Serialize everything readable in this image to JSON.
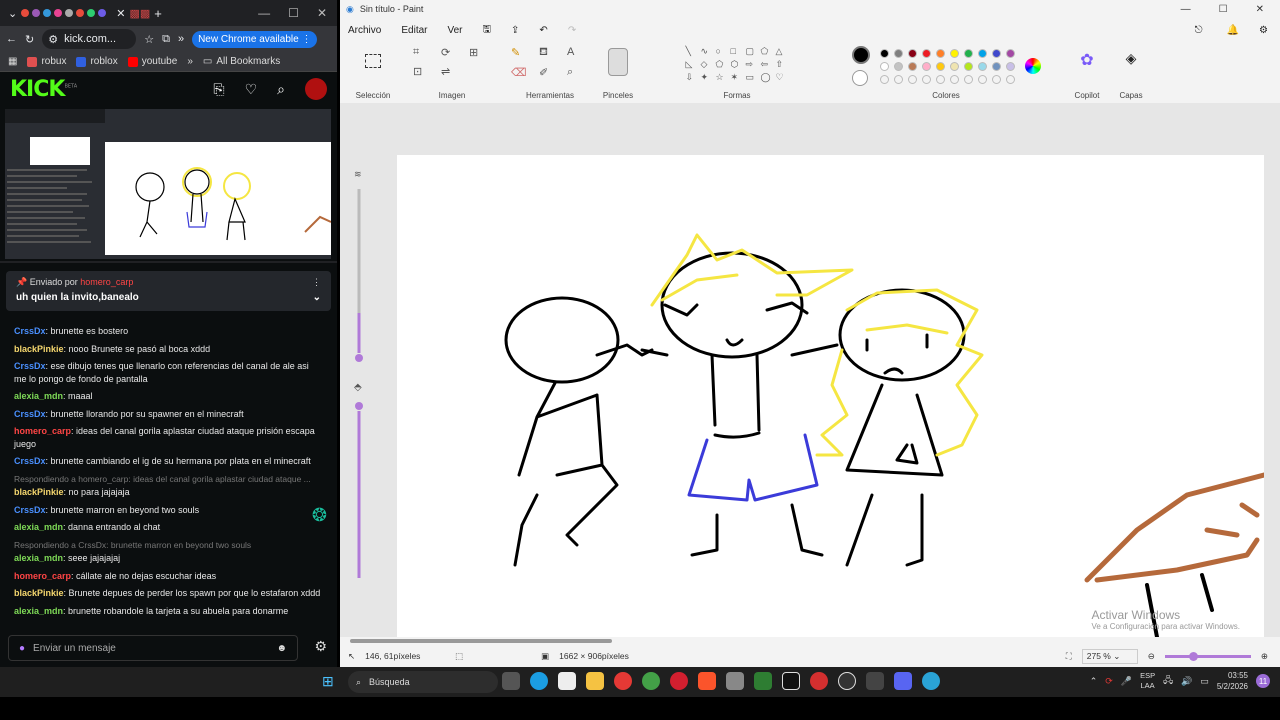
{
  "chrome": {
    "address_url": "kick.com...",
    "new_chrome_label": "New Chrome available",
    "bookmarks": [
      {
        "label": "robux",
        "color": "#e05050"
      },
      {
        "label": "roblox",
        "color": "#3060e0"
      },
      {
        "label": "youtube",
        "color": "#ff0000"
      }
    ],
    "bookmarks_more": "»",
    "all_bookmarks": "All Bookmarks"
  },
  "kick": {
    "logo": "KICK",
    "beta": "BETA",
    "brand_color": "#53fc18",
    "pinned": {
      "by_prefix": "Enviado por",
      "by_user": "homero_carp",
      "message": "uh quien la invito,banealo"
    },
    "chat": [
      {
        "user": "CrssDx",
        "color": "#4a90ff",
        "text": "brunette es bostero"
      },
      {
        "user": "blackPinkie",
        "color": "#f5d76e",
        "text": "nooo Brunete se pasó al boca xddd"
      },
      {
        "user": "CrssDx",
        "color": "#4a90ff",
        "text": "ese dibujo tenes que llenarlo con referencias del canal de ale asi me lo pongo de fondo de pantalla"
      },
      {
        "user": "alexia_mdn",
        "color": "#7ed957",
        "text": "maaal"
      },
      {
        "user": "CrssDx",
        "color": "#4a90ff",
        "text": "brunette llorando por su spawner en el minecraft"
      },
      {
        "user": "homero_carp",
        "color": "#ff4545",
        "text": "ideas del canal gorila aplastar ciudad ataque prisión escapa juego"
      },
      {
        "user": "CrssDx",
        "color": "#4a90ff",
        "text": "brunette cambiando el ig de su hermana por plata en el minecraft"
      },
      {
        "reply": "Respondiendo a homero_carp: ideas del canal gorila aplastar ciudad ataque ...",
        "user": "blackPinkie",
        "color": "#f5d76e",
        "text": "no para jajajaja"
      },
      {
        "user": "CrssDx",
        "color": "#4a90ff",
        "text": "brunette marron en beyond two souls"
      },
      {
        "user": "alexia_mdn",
        "color": "#7ed957",
        "text": "danna entrando al chat"
      },
      {
        "reply": "Respondiendo a CrssDx: brunette marron en beyond two souls",
        "user": "alexia_mdn",
        "color": "#7ed957",
        "text": "seee jajajajaj"
      },
      {
        "user": "homero_carp",
        "color": "#ff4545",
        "text": "cállate ale no dejas escuchar ideas"
      },
      {
        "user": "blackPinkie",
        "color": "#f5d76e",
        "text": "Brunete depues de perder los spawn por que lo estafaron xddd"
      },
      {
        "user": "alexia_mdn",
        "color": "#7ed957",
        "text": "brunette robandole la tarjeta a su abuela para donarme"
      }
    ],
    "input_placeholder": "Enviar un mensaje"
  },
  "paint": {
    "title": "Sin título - Paint",
    "menu": [
      "Archivo",
      "Editar",
      "Ver"
    ],
    "groups": {
      "seleccion": "Selección",
      "imagen": "Imagen",
      "herramientas": "Herramientas",
      "pinceles": "Pinceles",
      "formas": "Formas",
      "colores": "Colores",
      "copilot": "Copilot",
      "capas": "Capas"
    },
    "palette_row1": [
      "#000000",
      "#7f7f7f",
      "#880015",
      "#ed1c24",
      "#ff7f27",
      "#fff200",
      "#22b14c",
      "#00a2e8",
      "#3f48cc",
      "#a349a4"
    ],
    "palette_row2": [
      "#ffffff",
      "#c3c3c3",
      "#b97a57",
      "#ffaec9",
      "#ffc90e",
      "#efe4b0",
      "#b5e61d",
      "#99d9ea",
      "#7092be",
      "#c8bfe7"
    ],
    "status": {
      "cursor": "146, 61píxeles",
      "canvas_size": "1662 × 906píxeles",
      "zoom": "275 %"
    },
    "watermark": {
      "line1": "Activar Windows",
      "line2": "Ve a Configuración para activar Windows."
    }
  },
  "taskbar": {
    "search_label": "Búsqueda",
    "lang_line1": "ESP",
    "lang_line2": "LAA",
    "time": "03:55",
    "date": "5/2/2026",
    "notifications": "11"
  }
}
